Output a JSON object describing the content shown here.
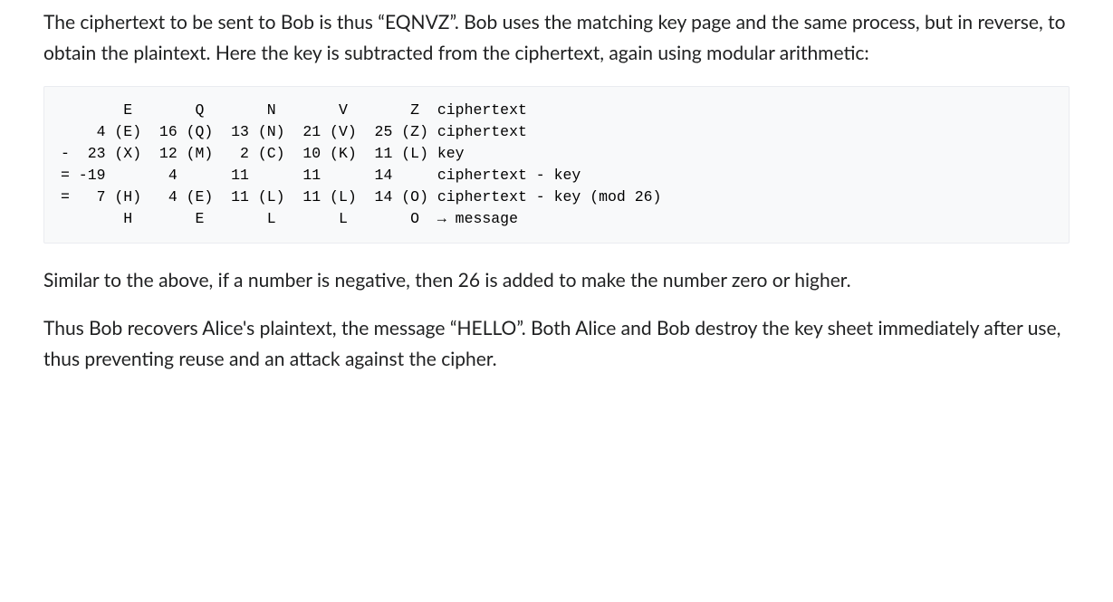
{
  "paragraphs": {
    "p1": "The ciphertext to be sent to Bob is thus “EQNVZ”. Bob uses the matching key page and the same process, but in reverse, to obtain the plaintext. Here the key is subtracted from the ciphertext, again using modular arithmetic:",
    "p2": "Similar to the above, if a number is negative, then 26 is added to make the number zero or higher.",
    "p3": "Thus Bob recovers Alice's plaintext, the message “HELLO”. Both Alice and Bob destroy the key sheet immediately after use, thus preventing reuse and an attack against the cipher."
  },
  "code": "       E       Q       N       V       Z  ciphertext\n    4 (E)  16 (Q)  13 (N)  21 (V)  25 (Z) ciphertext\n-  23 (X)  12 (M)   2 (C)  10 (K)  11 (L) key\n= -19       4      11      11      14     ciphertext - key\n=   7 (H)   4 (E)  11 (L)  11 (L)  14 (O) ciphertext - key (mod 26)\n       H       E       L       L       O  → message"
}
